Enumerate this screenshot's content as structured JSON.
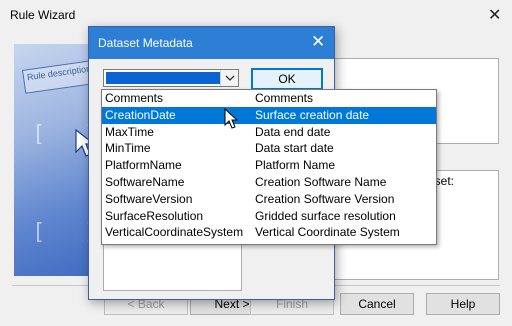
{
  "wizard": {
    "title": "Rule Wizard",
    "art_label": "Rule description (c",
    "dataset_label": "aset:",
    "buttons": {
      "back": "< Back",
      "next": "Next >",
      "finish": "Finish",
      "cancel": "Cancel",
      "help": "Help"
    }
  },
  "dialog": {
    "title": "Dataset Metadata",
    "ok_label": "OK"
  },
  "dropdown": {
    "highlighted_index": 1,
    "rows": [
      {
        "key": "Comments",
        "description": "Comments"
      },
      {
        "key": "CreationDate",
        "description": "Surface creation date"
      },
      {
        "key": "MaxTime",
        "description": "Data end date"
      },
      {
        "key": "MinTime",
        "description": "Data start date"
      },
      {
        "key": "PlatformName",
        "description": "Platform Name"
      },
      {
        "key": "SoftwareName",
        "description": "Creation Software Name"
      },
      {
        "key": "SoftwareVersion",
        "description": "Creation Software Version"
      },
      {
        "key": "SurfaceResolution",
        "description": "Gridded surface resolution"
      },
      {
        "key": "VerticalCoordinateSystem",
        "description": "Vertical Coordinate System"
      }
    ]
  },
  "colors": {
    "title_bar": "#2d7fd6",
    "highlight": "#0078d7"
  }
}
